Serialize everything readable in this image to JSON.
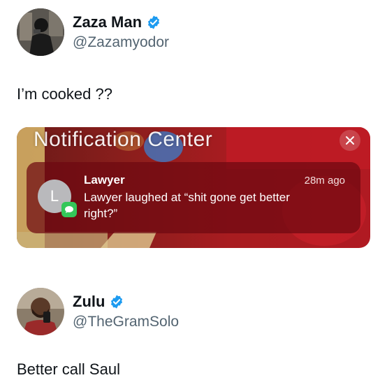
{
  "posts": [
    {
      "display_name": "Zaza Man",
      "handle": "@Zazamyodor",
      "verified": true,
      "text": "I’m cooked ??",
      "media": {
        "notification_center": {
          "title": "Notification Center",
          "close_icon": "close-icon",
          "notification": {
            "avatar_letter": "L",
            "sender": "Lawyer",
            "time": "28m ago",
            "body": "Lawyer laughed at “shit gone get better right?”",
            "app_icon": "messages-icon"
          }
        }
      }
    },
    {
      "display_name": "Zulu",
      "handle": "@TheGramSolo",
      "verified": true,
      "text": "Better call Saul"
    }
  ],
  "colors": {
    "verified_blue": "#1d9bf0",
    "handle_gray": "#536471",
    "text": "#0f1419",
    "notification_red": "#6e0810",
    "messages_green": "#34c759"
  }
}
